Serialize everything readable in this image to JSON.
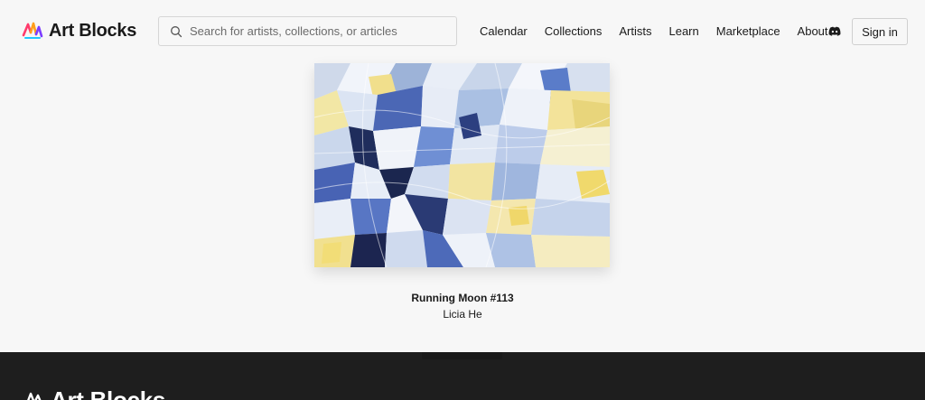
{
  "brand": {
    "name": "Art Blocks",
    "accent_colors": [
      "#ff3b6b",
      "#ff9f1c",
      "#7b3cff",
      "#1ec7ff"
    ]
  },
  "header": {
    "search_placeholder": "Search for artists, collections, or articles",
    "nav": [
      {
        "label": "Calendar"
      },
      {
        "label": "Collections"
      },
      {
        "label": "Artists"
      },
      {
        "label": "Learn"
      },
      {
        "label": "Marketplace"
      },
      {
        "label": "About"
      }
    ],
    "discord_icon": "discord-icon",
    "signin_label": "Sign in"
  },
  "featured": {
    "title": "Running Moon #113",
    "artist": "Licia He"
  },
  "footer": {
    "brand": "Art Blocks",
    "background": "#1e1e1e"
  }
}
